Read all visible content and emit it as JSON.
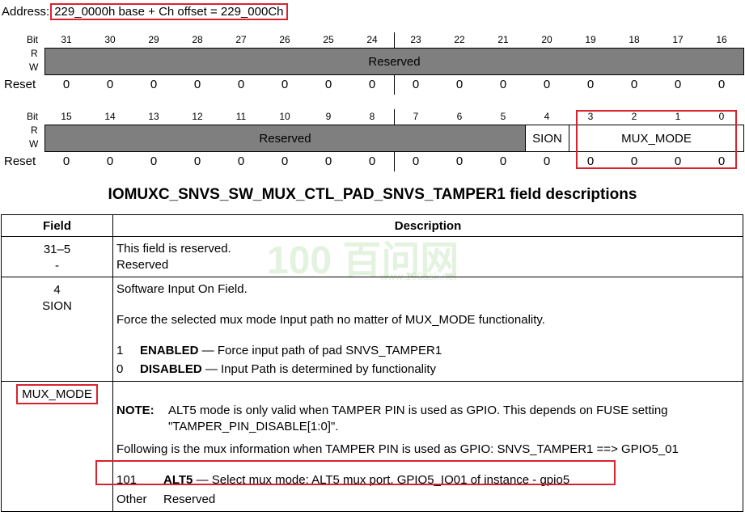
{
  "address": {
    "label": "Address:",
    "value": "229_0000h base + Ch offset = 229_000Ch"
  },
  "register": {
    "labels": {
      "bit": "Bit",
      "r": "R",
      "w": "W",
      "reset": "Reset"
    },
    "upper": {
      "bits": [
        "31",
        "30",
        "29",
        "28",
        "27",
        "26",
        "25",
        "24",
        "23",
        "22",
        "21",
        "20",
        "19",
        "18",
        "17",
        "16"
      ],
      "reserved_label": "Reserved",
      "reset": [
        "0",
        "0",
        "0",
        "0",
        "0",
        "0",
        "0",
        "0",
        "0",
        "0",
        "0",
        "0",
        "0",
        "0",
        "0",
        "0"
      ]
    },
    "lower": {
      "bits": [
        "15",
        "14",
        "13",
        "12",
        "11",
        "10",
        "9",
        "8",
        "7",
        "6",
        "5",
        "4",
        "3",
        "2",
        "1",
        "0"
      ],
      "reserved_label": "Reserved",
      "sion_label": "SION",
      "mux_mode_label": "MUX_MODE",
      "reset": [
        "0",
        "0",
        "0",
        "0",
        "0",
        "0",
        "0",
        "0",
        "0",
        "0",
        "0",
        "0",
        "0",
        "0",
        "0",
        "0"
      ]
    }
  },
  "title": "IOMUXC_SNVS_SW_MUX_CTL_PAD_SNVS_TAMPER1 field descriptions",
  "table": {
    "headers": {
      "field": "Field",
      "description": "Description"
    },
    "row1": {
      "field_line1": "31–5",
      "field_line2": "-",
      "desc_line1": "This field is reserved.",
      "desc_line2": "Reserved"
    },
    "row2": {
      "field_line1": "4",
      "field_line2": "SION",
      "desc_line1": "Software Input On Field.",
      "desc_line2": "Force the selected mux mode Input path no matter of MUX_MODE functionality.",
      "enum1_value": "1",
      "enum1_name": "ENABLED",
      "enum1_text": " — Force input path of pad SNVS_TAMPER1",
      "enum2_value": "0",
      "enum2_name": "DISABLED",
      "enum2_text": " — Input Path is determined by functionality"
    },
    "row3": {
      "field": "MUX_MODE",
      "note_label": "NOTE:",
      "note_line1": "ALT5 mode is only valid when TAMPER PIN is used as GPIO. This depends on FUSE setting",
      "note_line2": "\"TAMPER_PIN_DISABLE[1:0]\".",
      "mux_info": "Following is the mux information when TAMPER PIN is used as GPIO: SNVS_TAMPER1 ==> GPIO5_01",
      "opt1_value": "101",
      "opt1_name": "ALT5",
      "opt1_text": " — Select mux mode: ALT5 mux port, GPIO5_IO01 of instance - gpio5",
      "opt2_value": "Other",
      "opt2_text": "Reserved"
    }
  },
  "watermark": {
    "text": "100 百问网",
    "url": "www.100ask.net"
  },
  "colors": {
    "highlight": "#d9232e",
    "reserved_fill": "#7f7f7f",
    "watermark": "#cfe9c8"
  }
}
